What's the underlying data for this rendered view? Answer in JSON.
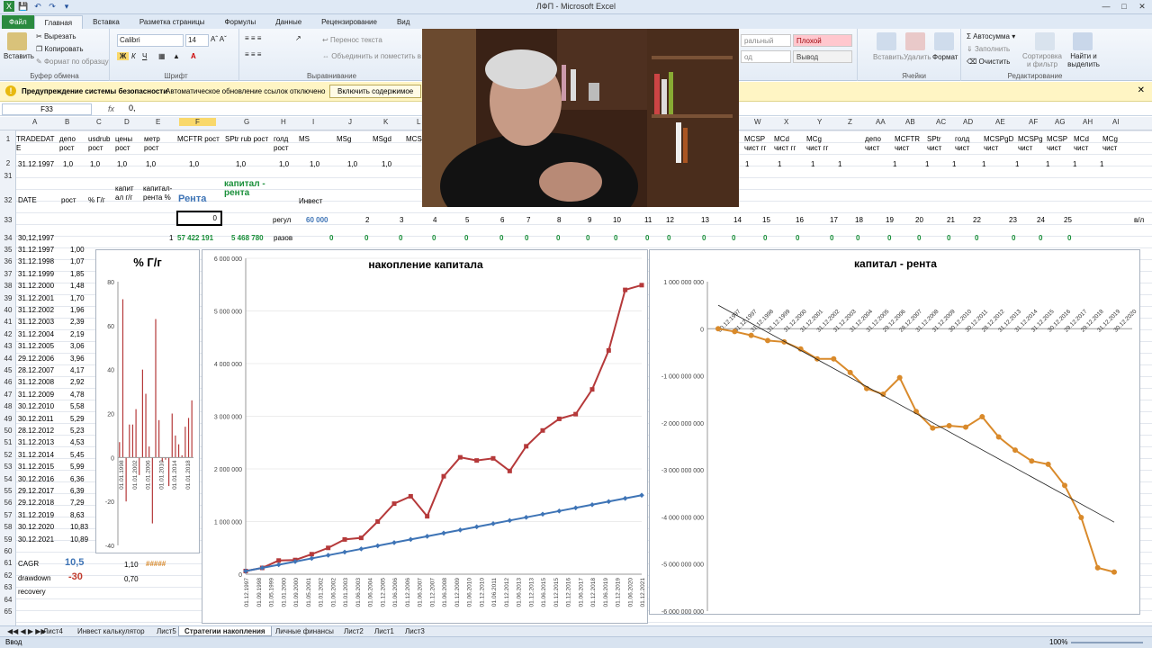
{
  "window": {
    "title": "ЛФП - Microsoft Excel"
  },
  "ribbon_tabs": [
    "Файл",
    "Главная",
    "Вставка",
    "Разметка страницы",
    "Формулы",
    "Данные",
    "Рецензирование",
    "Вид"
  ],
  "ribbon": {
    "paste": "Вставить",
    "cut": "Вырезать",
    "copy": "Копировать",
    "format_painter": "Формат по образцу",
    "clipboard_group": "Буфер обмена",
    "font_name": "Calibri",
    "font_size": "14",
    "font_group": "Шрифт",
    "wrap_text": "Перенос текста",
    "merge_center": "Объединить и поместить в",
    "alignment_group": "Выравнивание",
    "style_normal": "ральный",
    "style_bad": "Плохой",
    "style_neutral": "од",
    "style_output": "Вывод",
    "insert_cells": "Вставить",
    "delete_cells": "Удалить",
    "format_cells": "Формат",
    "cells_group": "Ячейки",
    "autosum": "Автосумма",
    "fill": "Заполнить",
    "clear": "Очистить",
    "sort_filter": "Сортировка и фильтр",
    "find_select": "Найти и выделить",
    "editing_group": "Редактирование"
  },
  "security_bar": {
    "title": "Предупреждение системы безопасности",
    "message": "Автоматическое обновление ссылок отключено",
    "button": "Включить содержимое"
  },
  "formula_bar": {
    "name_box": "F33",
    "fx": "fx",
    "value": "0,"
  },
  "columns": [
    "A",
    "B",
    "C",
    "D",
    "E",
    "F",
    "G",
    "H",
    "I",
    "J",
    "K",
    "L",
    "W",
    "X",
    "Y",
    "Z",
    "AA",
    "AB",
    "AC",
    "AD",
    "AE",
    "AF",
    "AG",
    "AH",
    "AI"
  ],
  "rows": [
    "1",
    "2",
    "31",
    "32",
    "33",
    "34",
    "35",
    "36",
    "37",
    "38",
    "39",
    "40",
    "41",
    "42",
    "43",
    "44",
    "45",
    "46",
    "47",
    "48",
    "49",
    "50",
    "51",
    "52",
    "53",
    "54",
    "55",
    "56",
    "57",
    "58",
    "59",
    "60",
    "61",
    "62",
    "63",
    "64",
    "65"
  ],
  "row1_headers": {
    "A": "TRADEDAT E",
    "B": "депо рост",
    "C": "usdrub рост",
    "D": "цены рост",
    "E": "метр рост",
    "F": "MCFTR рост",
    "G": "SPtr rub рост",
    "H": "голд рост",
    "I": "MS",
    "J": "MSg",
    "K": "MSgd",
    "L": "MCS",
    "W": "MCSP чист гг",
    "X": "MCd чист гг",
    "Y": "MCg чист гг",
    "AA": "депо чист",
    "AB": "MCFTR чист",
    "AC": "SPtr чист",
    "AD": "голд чист",
    "AE": "MCSPgD чист",
    "AF": "MCSPg чист",
    "AG": "MCSP чист",
    "AH": "MCd чист",
    "AI": "MCg чист"
  },
  "row2": {
    "date": "31.12.1997",
    "values": [
      "1,0",
      "1,0",
      "1,0",
      "1,0",
      "1,0",
      "1,0",
      "1,0",
      "1,0",
      "1,0",
      "1,0"
    ],
    "right_ones": [
      "1",
      "1",
      "1",
      "1",
      "1",
      "1",
      "1",
      "1",
      "1",
      "1",
      "1",
      "1"
    ]
  },
  "row32": {
    "A": "DATE",
    "B": "рост",
    "C": "% Г/г",
    "D": "капит ал г/г",
    "E": "капитал-рента %",
    "F": "Рента",
    "G": "капитал - рента",
    "I": "Инвест"
  },
  "row33": {
    "F": "0",
    "H": "регул",
    "I": "60 000",
    "numbers": [
      "2",
      "3",
      "4",
      "5",
      "6",
      "7",
      "8",
      "9",
      "10",
      "11",
      "12",
      "13",
      "14",
      "15",
      "16",
      "17",
      "18",
      "19",
      "20",
      "21",
      "22",
      "23",
      "24",
      "25"
    ],
    "AI": "в/л"
  },
  "row34": {
    "A": "30,12,1997",
    "E": "1",
    "F": "57 422 191",
    "G": "5 468 780",
    "H": "разов",
    "zeros": "0"
  },
  "data_rows": [
    {
      "date": "31.12.1997",
      "v": "1,00"
    },
    {
      "date": "31.12.1998",
      "v": "1,07"
    },
    {
      "date": "31.12.1999",
      "v": "1,85"
    },
    {
      "date": "31.12.2000",
      "v": "1,48"
    },
    {
      "date": "31.12.2001",
      "v": "1,70"
    },
    {
      "date": "31.12.2002",
      "v": "1,96"
    },
    {
      "date": "31.12.2003",
      "v": "2,39"
    },
    {
      "date": "31.12.2004",
      "v": "2,19"
    },
    {
      "date": "31.12.2005",
      "v": "3,06"
    },
    {
      "date": "29.12.2006",
      "v": "3,96"
    },
    {
      "date": "28.12.2007",
      "v": "4,17"
    },
    {
      "date": "31.12.2008",
      "v": "2,92"
    },
    {
      "date": "31.12.2009",
      "v": "4,78"
    },
    {
      "date": "30.12.2010",
      "v": "5,58"
    },
    {
      "date": "30.12.2011",
      "v": "5,29"
    },
    {
      "date": "28.12.2012",
      "v": "5,23"
    },
    {
      "date": "31.12.2013",
      "v": "4,53"
    },
    {
      "date": "31.12.2014",
      "v": "5,45"
    },
    {
      "date": "31.12.2015",
      "v": "5,99"
    },
    {
      "date": "30.12.2016",
      "v": "6,36"
    },
    {
      "date": "29.12.2017",
      "v": "6,39"
    },
    {
      "date": "29.12.2018",
      "v": "7,29"
    },
    {
      "date": "31.12.2019",
      "v": "8,63"
    },
    {
      "date": "30.12.2020",
      "v": "10,83"
    },
    {
      "date": "30.12.2021",
      "v": "10,89"
    }
  ],
  "summary": {
    "cagr_label": "CAGR",
    "cagr_value": "10,5",
    "cagr_c": "1,10",
    "cagr_d": "#####",
    "drawdown_label": "drawdown",
    "drawdown_value": "-30",
    "drawdown_c": "0,70",
    "recovery_label": "recovery"
  },
  "colors": {
    "red_series": "#b5393a",
    "blue_series": "#3e74b6",
    "orange_series": "#d98a2b",
    "green_text": "#1a8f3a",
    "excel_green": "#2a8a3e"
  },
  "chart_data": [
    {
      "type": "bar",
      "title": "% Г/г",
      "ylim": [
        -40,
        80
      ],
      "yticks": [
        "80",
        "60",
        "40",
        "20",
        "0",
        "-20",
        "-40"
      ],
      "xticks": [
        "01.01.1998",
        "01.01.2002",
        "01.01.2006",
        "01.01.2010",
        "01.01.2014",
        "01.01.2018"
      ],
      "values": [
        7,
        72,
        -20,
        15,
        15,
        22,
        -8,
        40,
        29,
        5,
        -30,
        63,
        17,
        -2,
        -1,
        -13,
        20,
        10,
        6,
        1,
        14,
        18,
        26
      ]
    },
    {
      "type": "line",
      "title": "накопление капитала",
      "ylim": [
        0,
        6000000
      ],
      "yticks": [
        "6 000 000",
        "5 000 000",
        "4 000 000",
        "3 000 000",
        "2 000 000",
        "1 000 000",
        "0"
      ],
      "x": [
        "01.12.1997",
        "01.09.1998",
        "01.05.1999",
        "01.01.2000",
        "01.09.2000",
        "01.05.2001",
        "01.01.2002",
        "01.06.2002",
        "01.01.2003",
        "01.06.2003",
        "01.06.2004",
        "01.12.2005",
        "01.06.2006",
        "01.12.2006",
        "01.06.2007",
        "01.12.2007",
        "01.06.2008",
        "01.12.2009",
        "01.06.2010",
        "01.12.2010",
        "01.06.2011",
        "01.12.2012",
        "01.06.2013",
        "01.12.2013",
        "01.06.2015",
        "01.12.2015",
        "01.12.2016",
        "01.06.2017",
        "01.12.2018",
        "01.06.2019",
        "01.12.2019",
        "01.06.2020",
        "01.12.2021"
      ],
      "series": [
        {
          "values": [
            60000,
            120000,
            260000,
            270000,
            380000,
            500000,
            660000,
            690000,
            1000000,
            1340000,
            1480000,
            1100000,
            1860000,
            2220000,
            2160000,
            2200000,
            1960000,
            2430000,
            2730000,
            2950000,
            3040000,
            3510000,
            4250000,
            5400000,
            5490000
          ]
        },
        {
          "values": [
            60000,
            120000,
            180000,
            240000,
            300000,
            360000,
            420000,
            480000,
            540000,
            600000,
            660000,
            720000,
            780000,
            840000,
            900000,
            960000,
            1020000,
            1080000,
            1140000,
            1200000,
            1260000,
            1320000,
            1380000,
            1440000,
            1500000
          ]
        }
      ]
    },
    {
      "type": "line",
      "title": "капитал - рента",
      "ylim": [
        -6000000000,
        1000000000
      ],
      "yticks": [
        "1 000 000 000",
        "0",
        "-1 000 000 000",
        "-2 000 000 000",
        "-3 000 000 000",
        "-4 000 000 000",
        "-5 000 000 000",
        "-6 000 000 000"
      ],
      "x": [
        "30.12.1997",
        "31.12.1997",
        "31.12.1998",
        "31.12.1999",
        "31.12.2000",
        "31.12.2001",
        "31.12.2002",
        "31.12.2003",
        "31.12.2004",
        "31.12.2005",
        "29.12.2006",
        "28.12.2007",
        "31.12.2008",
        "31.12.2009",
        "30.12.2010",
        "30.12.2011",
        "28.12.2012",
        "31.12.2013",
        "31.12.2014",
        "31.12.2015",
        "30.12.2016",
        "29.12.2017",
        "29.12.2018",
        "31.12.2019",
        "30.12.2020"
      ],
      "series": [
        {
          "values": [
            0,
            -60000000,
            -140000000,
            -250000000,
            -280000000,
            -430000000,
            -640000000,
            -640000000,
            -930000000,
            -1270000000,
            -1390000000,
            -1040000000,
            -1760000000,
            -2110000000,
            -2060000000,
            -2090000000,
            -1870000000,
            -2300000000,
            -2580000000,
            -2810000000,
            -2880000000,
            -3330000000,
            -4010000000,
            -5080000000,
            -5170000000
          ]
        }
      ],
      "trendline": true
    }
  ],
  "sheet_tabs": [
    "Лист4",
    "Инвест калькулятор",
    "Лист5",
    "Стратегии накопления",
    "Личные финансы",
    "Лист2",
    "Лист1",
    "Лист3"
  ],
  "active_sheet": "Стратегии накопления",
  "status": {
    "mode": "Ввод",
    "zoom": "100%"
  }
}
